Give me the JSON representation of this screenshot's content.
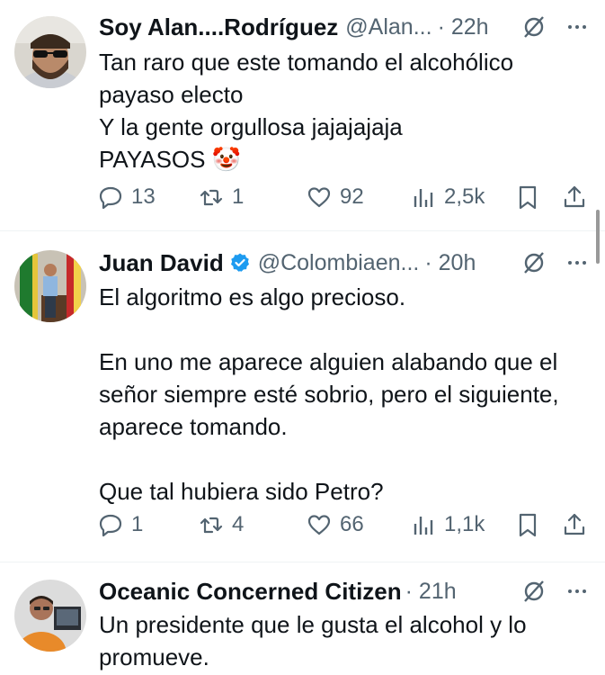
{
  "colors": {
    "text": "#0f1419",
    "secondary": "#536471",
    "verified": "#1d9bf0",
    "divider": "#eff3f4"
  },
  "tweets": [
    {
      "name": "Soy Alan....Rodríguez",
      "handle": "@Alan...",
      "time": "· 22h",
      "verified": false,
      "avatar_icon": "man-sunglasses-beard-avatar",
      "lines": [
        "Tan raro que este tomando el alcohólico",
        "payaso electo",
        "Y la gente orgullosa jajajajaja",
        "PAYASOS 🤡"
      ],
      "replies": "13",
      "reposts": "1",
      "likes": "92",
      "views": "2,5k"
    },
    {
      "name": "Juan David",
      "handle": "@Colombiaen...",
      "time": "· 20h",
      "verified": true,
      "avatar_icon": "man-at-podium-avatar",
      "lines": [
        "El algoritmo es algo precioso.",
        "",
        "En uno me aparece alguien alabando que el",
        "señor siempre esté sobrio, pero el siguiente,",
        "aparece tomando.",
        "",
        "Que tal hubiera sido Petro?"
      ],
      "replies": "1",
      "reposts": "4",
      "likes": "66",
      "views": "1,1k"
    },
    {
      "name": "Oceanic Concerned Citizen",
      "handle": "",
      "time": "· 21h",
      "verified": false,
      "avatar_icon": "man-orange-shirt-avatar",
      "lines": [
        "Un presidente que le gusta el alcohol y lo",
        "promueve."
      ]
    }
  ]
}
